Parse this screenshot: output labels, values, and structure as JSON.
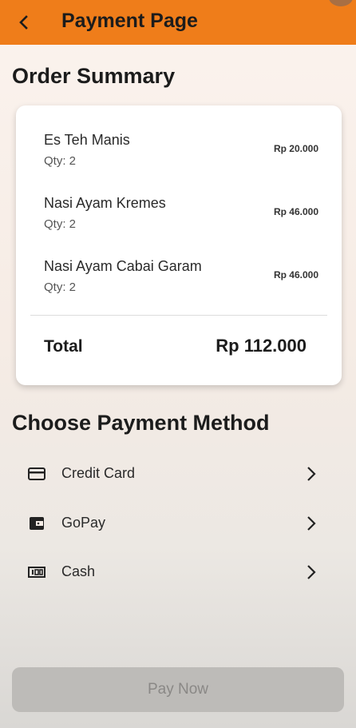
{
  "appbar": {
    "title": "Payment Page",
    "back_icon": "chevron-left-icon",
    "color": "#ef7d1a"
  },
  "order_summary": {
    "title": "Order Summary",
    "items": [
      {
        "name": "Es Teh Manis",
        "qty": "Qty: 2",
        "price": "Rp 20.000"
      },
      {
        "name": "Nasi Ayam Kremes",
        "qty": "Qty: 2",
        "price": "Rp 46.000"
      },
      {
        "name": "Nasi Ayam Cabai Garam",
        "qty": "Qty: 2",
        "price": "Rp 46.000"
      }
    ],
    "total_label": "Total",
    "total_value": "Rp 112.000"
  },
  "payment": {
    "title": "Choose Payment Method",
    "options": [
      {
        "label": "Credit Card",
        "icon": "credit-card-icon"
      },
      {
        "label": "GoPay",
        "icon": "wallet-icon"
      },
      {
        "label": "Cash",
        "icon": "cash-icon"
      }
    ]
  },
  "pay_button": {
    "label": "Pay Now",
    "state": "disabled"
  }
}
